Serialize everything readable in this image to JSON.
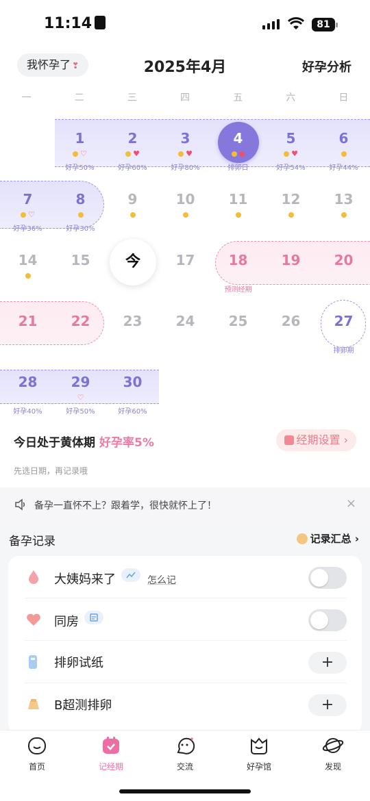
{
  "status_bar": {
    "time": "11:14",
    "battery": "81"
  },
  "header": {
    "pregnant_button": "我怀孕了",
    "month_title": "2025年4月",
    "analysis_link": "好孕分析"
  },
  "calendar": {
    "weekdays": [
      "一",
      "二",
      "三",
      "四",
      "五",
      "六",
      "日"
    ],
    "today_label": "今",
    "days": [
      {
        "d": "1",
        "sub": "好孕50%"
      },
      {
        "d": "2",
        "sub": "好孕60%"
      },
      {
        "d": "3",
        "sub": "好孕80%"
      },
      {
        "d": "4",
        "sub": "排卵日"
      },
      {
        "d": "5",
        "sub": "好孕54%"
      },
      {
        "d": "6",
        "sub": "好孕44%"
      },
      {
        "d": "7",
        "sub": "好孕36%"
      },
      {
        "d": "8",
        "sub": "好孕30%"
      },
      {
        "d": "9",
        "sub": ""
      },
      {
        "d": "10",
        "sub": ""
      },
      {
        "d": "11",
        "sub": ""
      },
      {
        "d": "12",
        "sub": ""
      },
      {
        "d": "13",
        "sub": ""
      },
      {
        "d": "14",
        "sub": ""
      },
      {
        "d": "15",
        "sub": ""
      },
      {
        "d": "16",
        "sub": ""
      },
      {
        "d": "17",
        "sub": ""
      },
      {
        "d": "18",
        "sub": "预测经期"
      },
      {
        "d": "19",
        "sub": ""
      },
      {
        "d": "20",
        "sub": ""
      },
      {
        "d": "21",
        "sub": ""
      },
      {
        "d": "22",
        "sub": ""
      },
      {
        "d": "23",
        "sub": ""
      },
      {
        "d": "24",
        "sub": ""
      },
      {
        "d": "25",
        "sub": ""
      },
      {
        "d": "26",
        "sub": ""
      },
      {
        "d": "27",
        "sub": "排卵期"
      },
      {
        "d": "28",
        "sub": "好孕40%"
      },
      {
        "d": "29",
        "sub": "好孕50%"
      },
      {
        "d": "30",
        "sub": "好孕60%"
      }
    ],
    "phase_text": "今日处于黄体期",
    "phase_rate": "好孕率5%",
    "period_settings": "经期设置",
    "hint": "先选日期，再记录哦"
  },
  "notice": {
    "text": "备孕一直怀不上？跟着学，很快就怀上了！",
    "close": "×"
  },
  "records": {
    "title": "备孕记录",
    "summary": "记录汇总",
    "items": [
      {
        "label": "大姨妈来了",
        "extra": "怎么记",
        "control": "toggle"
      },
      {
        "label": "同房",
        "control": "toggle"
      },
      {
        "label": "排卵试纸",
        "control": "plus"
      },
      {
        "label": "B超测排卵",
        "control": "plus"
      }
    ],
    "plus": "+"
  },
  "tabs": [
    {
      "label": "首页",
      "icon": "face-icon"
    },
    {
      "label": "记经期",
      "icon": "calendar-icon"
    },
    {
      "label": "交流",
      "icon": "chat-face-icon"
    },
    {
      "label": "好孕馆",
      "icon": "shop-icon"
    },
    {
      "label": "发现",
      "icon": "planet-icon"
    }
  ],
  "colors": {
    "accent_pink": "#ec6ea5",
    "ovulation_purple": "#8577db",
    "period_pink": "#e57aa0"
  }
}
